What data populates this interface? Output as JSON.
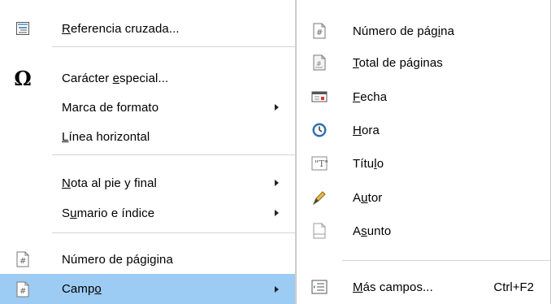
{
  "left_menu": {
    "items": [
      {
        "pre": "",
        "u": "R",
        "post": "eferencia cruzada...",
        "icon": "cross-reference-icon"
      },
      {
        "pre": "Carácter ",
        "u": "e",
        "post": "special...",
        "icon": "omega-icon"
      },
      {
        "pre": "Marca de formato",
        "u": "",
        "post": "",
        "submenu": true
      },
      {
        "pre": "",
        "u": "L",
        "post": "ínea horizontal"
      },
      {
        "pre": "",
        "u": "N",
        "post": "ota al pie y final",
        "submenu": true
      },
      {
        "pre": "S",
        "u": "u",
        "post": "mario e índice",
        "submenu": true
      },
      {
        "pre": "Número de pági",
        "u": "g",
        "post": "ina",
        "icon": "page-number-icon"
      },
      {
        "pre": "Camp",
        "u": "o",
        "post": "",
        "submenu": true,
        "icon": "field-icon",
        "highlighted": true
      }
    ]
  },
  "right_menu": {
    "items": [
      {
        "pre": "Número de pág",
        "u": "i",
        "post": "na",
        "icon": "page-number-icon"
      },
      {
        "pre": "",
        "u": "T",
        "post": "otal de páginas",
        "icon": "page-count-icon"
      },
      {
        "pre": "",
        "u": "F",
        "post": "echa",
        "icon": "calendar-icon"
      },
      {
        "pre": "",
        "u": "H",
        "post": "ora",
        "icon": "clock-icon"
      },
      {
        "pre": "Títu",
        "u": "l",
        "post": "o",
        "icon": "title-icon"
      },
      {
        "pre": "A",
        "u": "u",
        "post": "tor",
        "icon": "author-pen-icon"
      },
      {
        "pre": "A",
        "u": "s",
        "post": "unto",
        "icon": "subject-icon"
      },
      {
        "pre": "",
        "u": "M",
        "post": "ás campos...",
        "icon": "more-fields-icon",
        "shortcut": "Ctrl+F2"
      }
    ]
  },
  "colors": {
    "highlight": "#9ccbf3",
    "separator": "#d4d4d4"
  }
}
